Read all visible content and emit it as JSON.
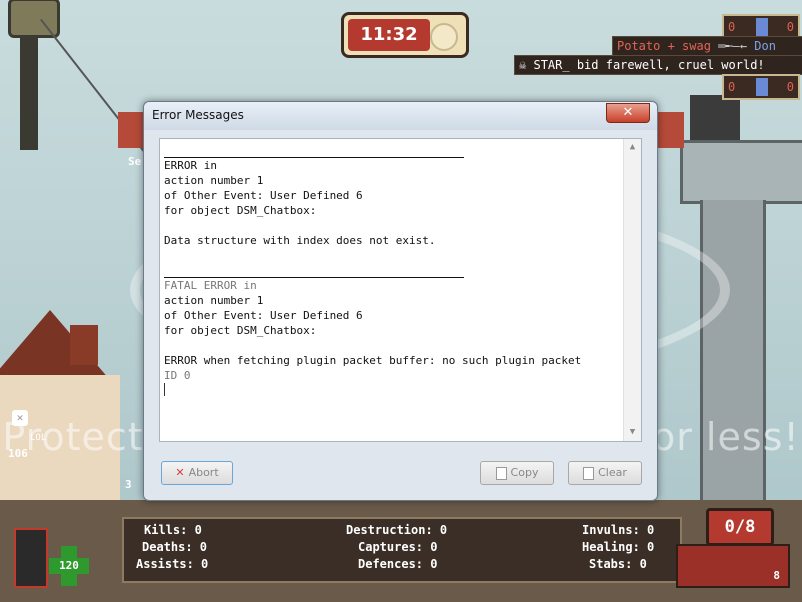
{
  "hud": {
    "timer": "11:32",
    "red_score_top": "0",
    "blue_score_top": "0",
    "red_score_bottom": "0",
    "blue_score_bottom": "0",
    "intel_score": "0/8",
    "corner_number": "8",
    "health": "120",
    "side_number": "106",
    "side_three": "3",
    "side_se": "Se",
    "side_label": "LOL"
  },
  "killfeed": [
    {
      "killer": "Potato + swag",
      "victim": "Don"
    },
    {
      "message": "STAR_ bid farewell, cruel world!"
    }
  ],
  "dialog": {
    "title": "Error Messages",
    "close_label": "✕",
    "lines": [
      {
        "type": "sep"
      },
      {
        "type": "text",
        "text": "ERROR in"
      },
      {
        "type": "text",
        "text": "action number 1"
      },
      {
        "type": "text",
        "text": "of Other Event: User Defined 6"
      },
      {
        "type": "text",
        "text": "for object DSM_Chatbox:"
      },
      {
        "type": "text",
        "text": ""
      },
      {
        "type": "text",
        "text": "Data structure with index does not exist."
      },
      {
        "type": "text",
        "text": ""
      },
      {
        "type": "sep"
      },
      {
        "type": "gray",
        "text": "FATAL ERROR in"
      },
      {
        "type": "text",
        "text": "action number 1"
      },
      {
        "type": "text",
        "text": "of Other Event: User Defined 6"
      },
      {
        "type": "text",
        "text": "for object DSM_Chatbox:"
      },
      {
        "type": "text",
        "text": ""
      },
      {
        "type": "text",
        "text": "ERROR when fetching plugin packet buffer: no such plugin packet"
      },
      {
        "type": "gray",
        "text": "ID 0"
      }
    ],
    "abort_label": "Abort",
    "copy_label": "Copy",
    "clear_label": "Clear"
  },
  "stats": {
    "kills": "Kills: 0",
    "deaths": "Deaths: 0",
    "assists": "Assists: 0",
    "destruction": "Destruction: 0",
    "captures": "Captures: 0",
    "defences": "Defences: 0",
    "invulns": "Invulns: 0",
    "healing": "Healing: 0",
    "stabs": "Stabs: 0"
  },
  "watermark": "Protect more of your memories for less!",
  "colors": {
    "accent_red": "#b43a30",
    "dialog_bg": "#dfe6ee",
    "health_green": "#2e9a2e"
  }
}
